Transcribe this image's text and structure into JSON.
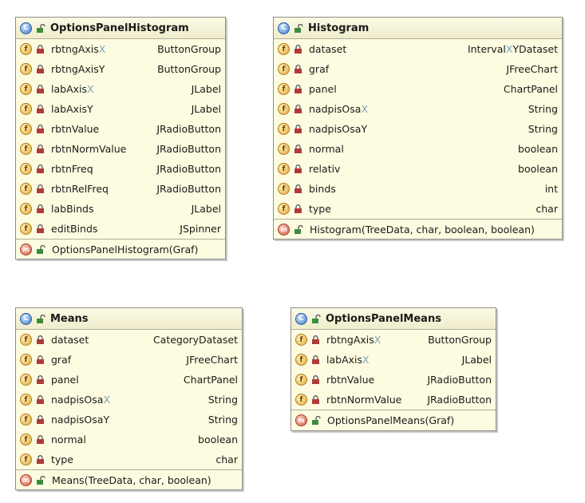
{
  "classes": {
    "options_panel_histogram": {
      "name": "OptionsPanelHistogram",
      "fields": [
        {
          "name": "rbtngAxis",
          "suffix": "X",
          "type": "ButtonGroup"
        },
        {
          "name": "rbtngAxisY",
          "suffix": "",
          "type": "ButtonGroup"
        },
        {
          "name": "labAxis",
          "suffix": "X",
          "type": "JLabel"
        },
        {
          "name": "labAxisY",
          "suffix": "",
          "type": "JLabel"
        },
        {
          "name": "rbtnValue",
          "suffix": "",
          "type": "JRadioButton"
        },
        {
          "name": "rbtnNormValue",
          "suffix": "",
          "type": "JRadioButton"
        },
        {
          "name": "rbtnFreq",
          "suffix": "",
          "type": "JRadioButton"
        },
        {
          "name": "rbtnRelFreq",
          "suffix": "",
          "type": "JRadioButton"
        },
        {
          "name": "labBinds",
          "suffix": "",
          "type": "JLabel"
        },
        {
          "name": "editBinds",
          "suffix": "",
          "type": "JSpinner"
        }
      ],
      "methods": [
        {
          "signature": "OptionsPanelHistogram(Graf)"
        }
      ]
    },
    "histogram": {
      "name": "Histogram",
      "fields": [
        {
          "name": "dataset",
          "suffix": "",
          "type_pre": "Interval",
          "type_mark": "X",
          "type_post": "YDataset"
        },
        {
          "name": "graf",
          "suffix": "",
          "type_pre": "JFreeChart",
          "type_mark": "",
          "type_post": ""
        },
        {
          "name": "panel",
          "suffix": "",
          "type_pre": "ChartPanel",
          "type_mark": "",
          "type_post": ""
        },
        {
          "name": "nadpisOsa",
          "suffix": "X",
          "type_pre": "String",
          "type_mark": "",
          "type_post": ""
        },
        {
          "name": "nadpisOsaY",
          "suffix": "",
          "type_pre": "String",
          "type_mark": "",
          "type_post": ""
        },
        {
          "name": "normal",
          "suffix": "",
          "type_pre": "boolean",
          "type_mark": "",
          "type_post": ""
        },
        {
          "name": "relativ",
          "suffix": "",
          "type_pre": "boolean",
          "type_mark": "",
          "type_post": ""
        },
        {
          "name": "binds",
          "suffix": "",
          "type_pre": "int",
          "type_mark": "",
          "type_post": ""
        },
        {
          "name": "type",
          "suffix": "",
          "type_pre": "char",
          "type_mark": "",
          "type_post": ""
        }
      ],
      "methods": [
        {
          "signature": "Histogram(TreeData, char, boolean, boolean)"
        }
      ]
    },
    "means": {
      "name": "Means",
      "fields": [
        {
          "name": "dataset",
          "suffix": "",
          "type": "CategoryDataset"
        },
        {
          "name": "graf",
          "suffix": "",
          "type": "JFreeChart"
        },
        {
          "name": "panel",
          "suffix": "",
          "type": "ChartPanel"
        },
        {
          "name": "nadpisOsa",
          "suffix": "X",
          "type": "String"
        },
        {
          "name": "nadpisOsaY",
          "suffix": "",
          "type": "String"
        },
        {
          "name": "normal",
          "suffix": "",
          "type": "boolean"
        },
        {
          "name": "type",
          "suffix": "",
          "type": "char"
        }
      ],
      "methods": [
        {
          "signature": "Means(TreeData, char, boolean)"
        }
      ]
    },
    "options_panel_means": {
      "name": "OptionsPanelMeans",
      "fields": [
        {
          "name": "rbtngAxis",
          "suffix": "X",
          "type": "ButtonGroup"
        },
        {
          "name": "labAxis",
          "suffix": "X",
          "type": "JLabel"
        },
        {
          "name": "rbtnValue",
          "suffix": "",
          "type": "JRadioButton"
        },
        {
          "name": "rbtnNormValue",
          "suffix": "",
          "type": "JRadioButton"
        }
      ],
      "methods": [
        {
          "signature": "OptionsPanelMeans(Graf)"
        }
      ]
    }
  },
  "icons": {
    "class_letter": "C",
    "field_letter": "f",
    "method_letter": "m",
    "class_icon_color": "#3f79c9",
    "field_icon_color": "#e0a83a",
    "method_icon_color": "#d15a42",
    "field_icon": "private-lock-icon",
    "member_icon": "public-unlocked-icon"
  }
}
